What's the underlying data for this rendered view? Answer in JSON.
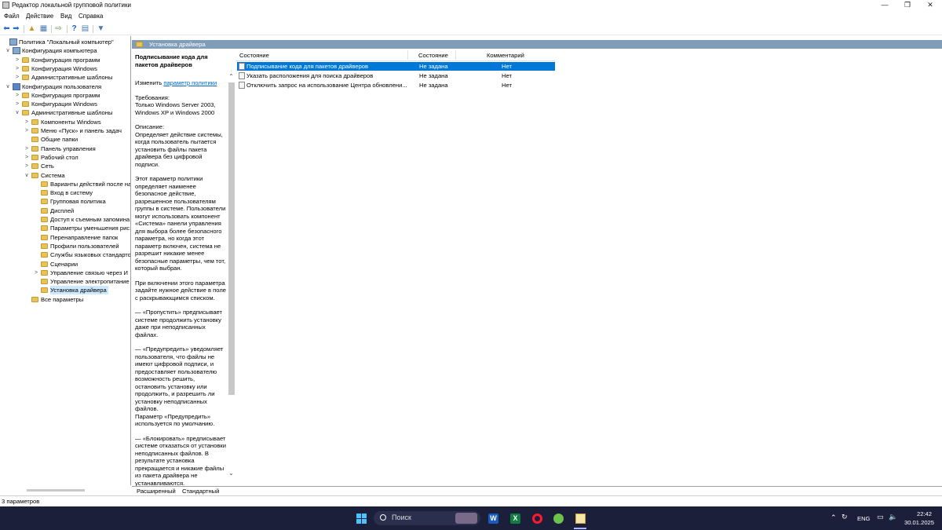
{
  "window": {
    "title": "Редактор локальной групповой политики",
    "minimize": "—",
    "maximize": "❐",
    "close": "✕"
  },
  "menu": [
    "Файл",
    "Действие",
    "Вид",
    "Справка"
  ],
  "tree": [
    {
      "label": "Политика \"Локальный компьютер\"",
      "level": 0,
      "expander": "",
      "icon": "policy-icon"
    },
    {
      "label": "Конфигурация компьютера",
      "level": 1,
      "expander": "∨",
      "icon": "computer-icon"
    },
    {
      "label": "Конфигурация программ",
      "level": 2,
      "expander": ">",
      "icon": "folder-icon"
    },
    {
      "label": "Конфигурация Windows",
      "level": 2,
      "expander": ">",
      "icon": "folder-icon"
    },
    {
      "label": "Административные шаблоны",
      "level": 2,
      "expander": ">",
      "icon": "folder-icon"
    },
    {
      "label": "Конфигурация пользователя",
      "level": 1,
      "expander": "∨",
      "icon": "user-icon"
    },
    {
      "label": "Конфигурация программ",
      "level": 2,
      "expander": ">",
      "icon": "folder-icon"
    },
    {
      "label": "Конфигурация Windows",
      "level": 2,
      "expander": ">",
      "icon": "folder-icon"
    },
    {
      "label": "Административные шаблоны",
      "level": 2,
      "expander": "∨",
      "icon": "folder-icon"
    },
    {
      "label": "Компоненты Windows",
      "level": 3,
      "expander": ">",
      "icon": "folder-icon"
    },
    {
      "label": "Меню «Пуск» и панель задач",
      "level": 3,
      "expander": ">",
      "icon": "folder-icon"
    },
    {
      "label": "Общие папки",
      "level": 3,
      "expander": "",
      "icon": "folder-icon"
    },
    {
      "label": "Панель управления",
      "level": 3,
      "expander": ">",
      "icon": "folder-icon"
    },
    {
      "label": "Рабочий стол",
      "level": 3,
      "expander": ">",
      "icon": "folder-icon"
    },
    {
      "label": "Сеть",
      "level": 3,
      "expander": ">",
      "icon": "folder-icon"
    },
    {
      "label": "Система",
      "level": 3,
      "expander": "∨",
      "icon": "folder-icon"
    },
    {
      "label": "Варианты действий после на",
      "level": 4,
      "expander": "",
      "icon": "folder-icon"
    },
    {
      "label": "Вход в систему",
      "level": 4,
      "expander": "",
      "icon": "folder-icon"
    },
    {
      "label": "Групповая политика",
      "level": 4,
      "expander": "",
      "icon": "folder-icon"
    },
    {
      "label": "Дисплей",
      "level": 4,
      "expander": "",
      "icon": "folder-icon"
    },
    {
      "label": "Доступ к съемным запомина",
      "level": 4,
      "expander": "",
      "icon": "folder-icon"
    },
    {
      "label": "Параметры уменьшения рис",
      "level": 4,
      "expander": "",
      "icon": "folder-icon"
    },
    {
      "label": "Перенаправление папок",
      "level": 4,
      "expander": "",
      "icon": "folder-icon"
    },
    {
      "label": "Профили пользователей",
      "level": 4,
      "expander": "",
      "icon": "folder-icon"
    },
    {
      "label": "Службы языковых стандарто",
      "level": 4,
      "expander": "",
      "icon": "folder-icon"
    },
    {
      "label": "Сценарии",
      "level": 4,
      "expander": "",
      "icon": "folder-icon"
    },
    {
      "label": "Управление связью через И",
      "level": 4,
      "expander": ">",
      "icon": "folder-icon"
    },
    {
      "label": "Управление электропитание",
      "level": 4,
      "expander": "",
      "icon": "folder-icon"
    },
    {
      "label": "Установка драйвера",
      "level": 4,
      "expander": "",
      "icon": "folder-icon",
      "selected": true
    },
    {
      "label": "Все параметры",
      "level": 3,
      "expander": "",
      "icon": "folder-icon"
    }
  ],
  "path": "Установка драйвера",
  "description": {
    "title": "Подписывание кода для пакетов драйверов",
    "edit_prefix": "Изменить ",
    "edit_link": "параметр политики",
    "paragraphs": [
      "Требования:\nТолько Windows Server 2003, Windows XP и Windows 2000",
      "Описание:\nОпределяет действие системы, когда пользователь пытается установить файлы пакета драйвера без цифровой подписи.",
      "Этот параметр политики определяет наименее безопасное действие, разрешенное пользователям группы в системе. Пользователи могут использовать компонент «Система» панели управления для выбора более безопасного параметра, но когда этот параметр включен, система не разрешит никакие менее безопасные параметры, чем тот, который выбран.",
      "При включении этого параметра задайте нужное действие в поле с раскрывающимся списком.",
      "—   «Пропустить» предписывает системе продолжить установку даже при неподписанных файлах.",
      "—   «Предупредить» уведомляет пользователя, что файлы не имеют цифровой подписи, и предоставляет пользователю возможность решить, остановить установку или продолжить, и разрешить ли установку неподписанных файлов.\nПараметр «Предупредить» используется по умолчанию.",
      "—   «Блокировать» предписывает системе отказаться от установки неподписанных файлов. В результате установка прекращается и никакие файлы из пакета драйвера не устанавливаются."
    ]
  },
  "list": {
    "columns": [
      "Состояние",
      "Состояние",
      "Комментарий"
    ],
    "rows": [
      {
        "name": "Подписывание кода для пакетов драйверов",
        "state": "Не задана",
        "comment": "Нет",
        "selected": true
      },
      {
        "name": "Указать расположения для поиска драйверов",
        "state": "Не задана",
        "comment": "Нет"
      },
      {
        "name": "Отключить запрос на использование Центра обновлени...",
        "state": "Не задана",
        "comment": "Нет"
      }
    ]
  },
  "tabs": [
    "Расширенный",
    "Стандартный"
  ],
  "status": "3 параметров",
  "taskbar": {
    "search_placeholder": "Поиск",
    "language": "ENG",
    "time": "22:42",
    "date": "30.01.2025"
  },
  "colors": {
    "selection": "#0078d7",
    "pathbar": "#7f9db9",
    "taskbar": "#1c1f3a"
  }
}
